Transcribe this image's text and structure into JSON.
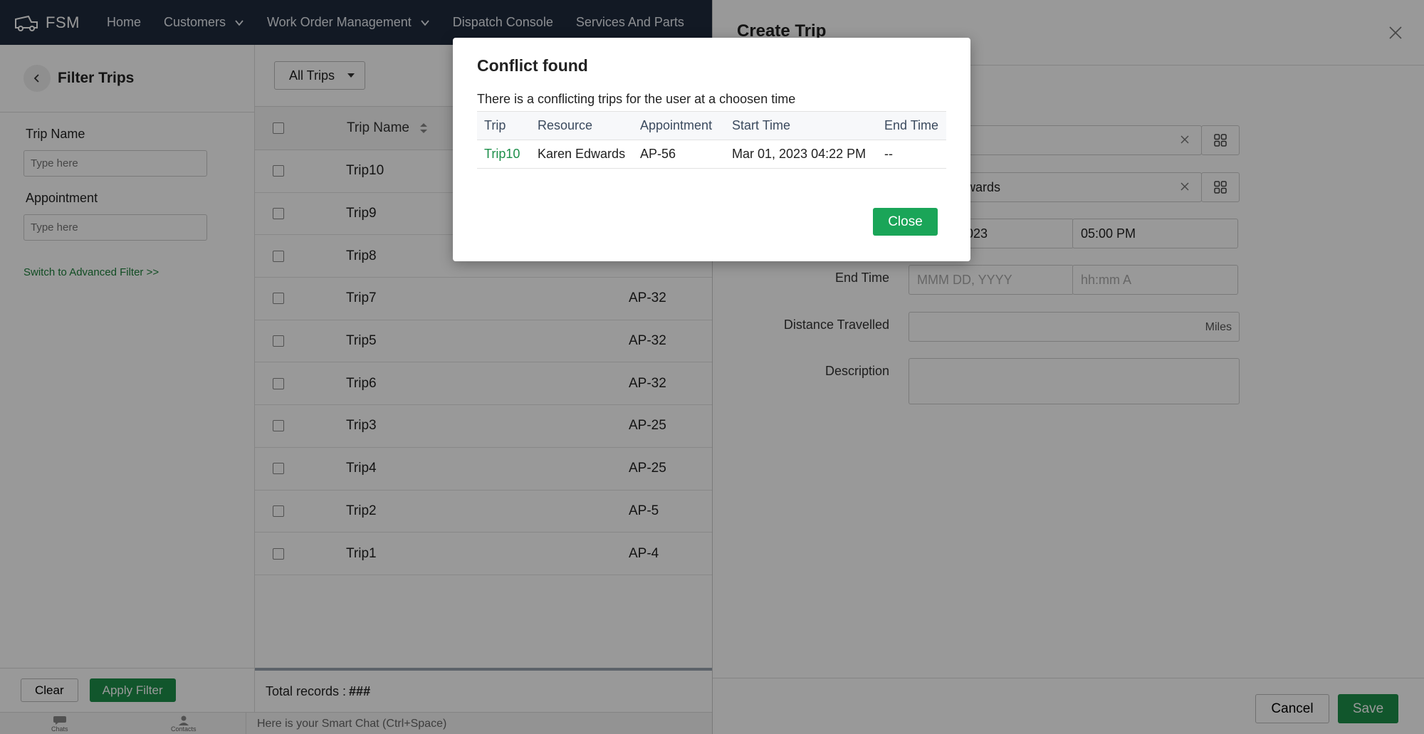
{
  "nav": {
    "brand": "FSM",
    "items": [
      {
        "label": "Home",
        "dropdown": false
      },
      {
        "label": "Customers",
        "dropdown": true
      },
      {
        "label": "Work Order Management",
        "dropdown": true
      },
      {
        "label": "Dispatch Console",
        "dropdown": false
      },
      {
        "label": "Services And Parts",
        "dropdown": false
      }
    ]
  },
  "filter": {
    "title": "Filter Trips",
    "trip_name_label": "Trip Name",
    "trip_name_placeholder": "Type here",
    "appointment_label": "Appointment",
    "appointment_placeholder": "Type here",
    "advanced_link": "Switch to Advanced Filter >>",
    "clear_label": "Clear",
    "apply_label": "Apply Filter"
  },
  "list": {
    "view_label": "All Trips",
    "column_trip_name": "Trip Name",
    "rows": [
      {
        "name": "Trip10",
        "appointment": ""
      },
      {
        "name": "Trip9",
        "appointment": ""
      },
      {
        "name": "Trip8",
        "appointment": ""
      },
      {
        "name": "Trip7",
        "appointment": "AP-32"
      },
      {
        "name": "Trip5",
        "appointment": "AP-32"
      },
      {
        "name": "Trip6",
        "appointment": "AP-32"
      },
      {
        "name": "Trip3",
        "appointment": "AP-25"
      },
      {
        "name": "Trip4",
        "appointment": "AP-25"
      },
      {
        "name": "Trip2",
        "appointment": "AP-5"
      },
      {
        "name": "Trip1",
        "appointment": "AP-4"
      }
    ],
    "total_label": "Total records :",
    "total_value": "###"
  },
  "bottombar": {
    "chats_label": "Chats",
    "contacts_label": "Contacts",
    "smart_chat": "Here is your Smart Chat (Ctrl+Space)"
  },
  "create_trip": {
    "title": "Create Trip",
    "resource_value": "wards",
    "start_date_value": "023",
    "start_time_value": "05:00 PM",
    "end_time_label": "End Time",
    "end_date_placeholder": "MMM DD, YYYY",
    "end_time_placeholder": "hh:mm A",
    "distance_label": "Distance Travelled",
    "distance_unit": "Miles",
    "description_label": "Description",
    "cancel_label": "Cancel",
    "save_label": "Save"
  },
  "modal": {
    "title": "Conflict found",
    "message": "There is a conflicting trips for the user at a choosen time",
    "columns": [
      "Trip",
      "Resource",
      "Appointment",
      "Start Time",
      "End Time"
    ],
    "row": {
      "trip": "Trip10",
      "resource": "Karen Edwards",
      "appointment": "AP-56",
      "start_time": "Mar 01, 2023 04:22 PM",
      "end_time": "--"
    },
    "close_label": "Close"
  },
  "colors": {
    "nav_bg": "#1f2a3c",
    "primary_green": "#1d8f4a",
    "link_green": "#1b7f3a"
  }
}
